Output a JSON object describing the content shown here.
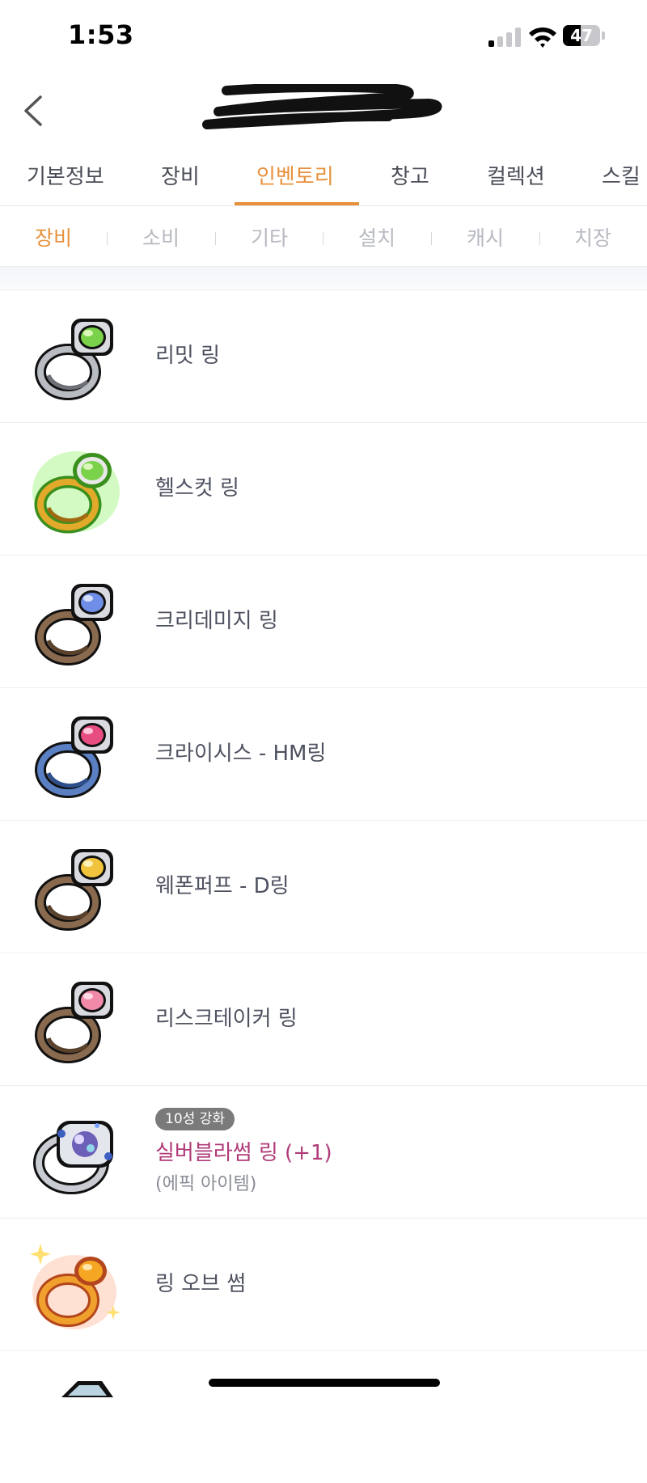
{
  "status_bar": {
    "time": "1:53",
    "battery": "47",
    "battery_level": 0.47
  },
  "header": {
    "back_icon": "chevron-left-icon",
    "title_redacted": true
  },
  "main_tabs": [
    {
      "label": "기본정보",
      "active": false
    },
    {
      "label": "장비",
      "active": false
    },
    {
      "label": "인벤토리",
      "active": true
    },
    {
      "label": "창고",
      "active": false
    },
    {
      "label": "컬렉션",
      "active": false
    },
    {
      "label": "스킬",
      "active": false
    }
  ],
  "sub_tabs": [
    {
      "label": "장비",
      "active": true
    },
    {
      "label": "소비",
      "active": false
    },
    {
      "label": "기타",
      "active": false
    },
    {
      "label": "설치",
      "active": false
    },
    {
      "label": "캐시",
      "active": false
    },
    {
      "label": "치장",
      "active": false
    }
  ],
  "items": [
    {
      "name": "리밋 링",
      "icon": "ring-silver-green-gem-icon"
    },
    {
      "name": "헬스컷 링",
      "icon": "ring-gold-green-glow-icon"
    },
    {
      "name": "크리데미지 링",
      "icon": "ring-bronze-blue-gem-icon"
    },
    {
      "name": "크라이시스 - HM링",
      "icon": "ring-blue-pink-gem-icon"
    },
    {
      "name": "웨폰퍼프 - D링",
      "icon": "ring-bronze-yellow-gem-icon"
    },
    {
      "name": "리스크테이커 링",
      "icon": "ring-bronze-pink-gem-icon"
    },
    {
      "name": "실버블라썸 링 (+1)",
      "icon": "ring-silver-blossom-icon",
      "badge": "10성 강화",
      "grade": "(에픽 아이템)",
      "grade_color": "#b03a78"
    },
    {
      "name": "링 오브 썸",
      "icon": "ring-gold-sparkle-icon"
    }
  ],
  "colors": {
    "accent": "#e8913c",
    "epic": "#b03a78"
  }
}
